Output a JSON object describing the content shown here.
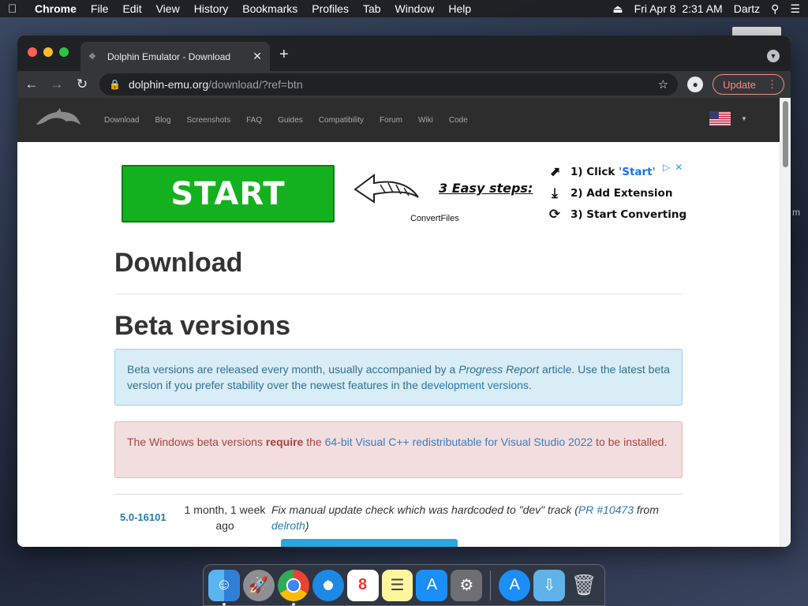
{
  "menubar": {
    "items": [
      "Chrome",
      "File",
      "Edit",
      "View",
      "History",
      "Bookmarks",
      "Profiles",
      "Tab",
      "Window",
      "Help"
    ],
    "datetime": "Fri Apr 8  2:31 AM",
    "user": "Dartz"
  },
  "browser": {
    "tab_title": "Dolphin Emulator - Download",
    "url_host": "dolphin-emu.org",
    "url_path": "/download/?ref=btn",
    "update_label": "Update"
  },
  "site": {
    "nav": [
      "Download",
      "Blog",
      "Screenshots",
      "FAQ",
      "Guides",
      "Compatibility",
      "Forum",
      "Wiki",
      "Code"
    ]
  },
  "ad": {
    "start_label": "START",
    "steps_title": "3 Easy steps:",
    "caption": "ConvertFiles",
    "step1_prefix": "1) Click ",
    "step1_highlight": "'Start'",
    "step2": "2) Add Extension",
    "step3": "3) Start Converting"
  },
  "page": {
    "title": "Download",
    "section": "Beta versions",
    "info": {
      "text1": "Beta versions are released every month, usually accompanied by a ",
      "em": "Progress Report",
      "text2": " article. Use the latest beta version if you prefer stability over the newest features in the ",
      "link": "development versions",
      "text3": "."
    },
    "warning": {
      "text1": "The Windows beta versions ",
      "strong": "require",
      "text2": " the ",
      "link": "64-bit Visual C++ redistributable for Visual Studio 2022",
      "text3": " to be installed."
    },
    "release": {
      "version": "5.0-16101",
      "age": "1 month, 1 week ago",
      "desc1": "Fix manual update check which was hardcoded to \"dev\" track (",
      "pr": "PR #10473",
      "desc2": " from ",
      "author": "delroth",
      "desc3": ")"
    }
  },
  "colors": {
    "accent_green": "#14b11f",
    "link_blue": "#2a7ab0",
    "info_bg": "#d9edf7",
    "danger_bg": "#f2dede"
  }
}
